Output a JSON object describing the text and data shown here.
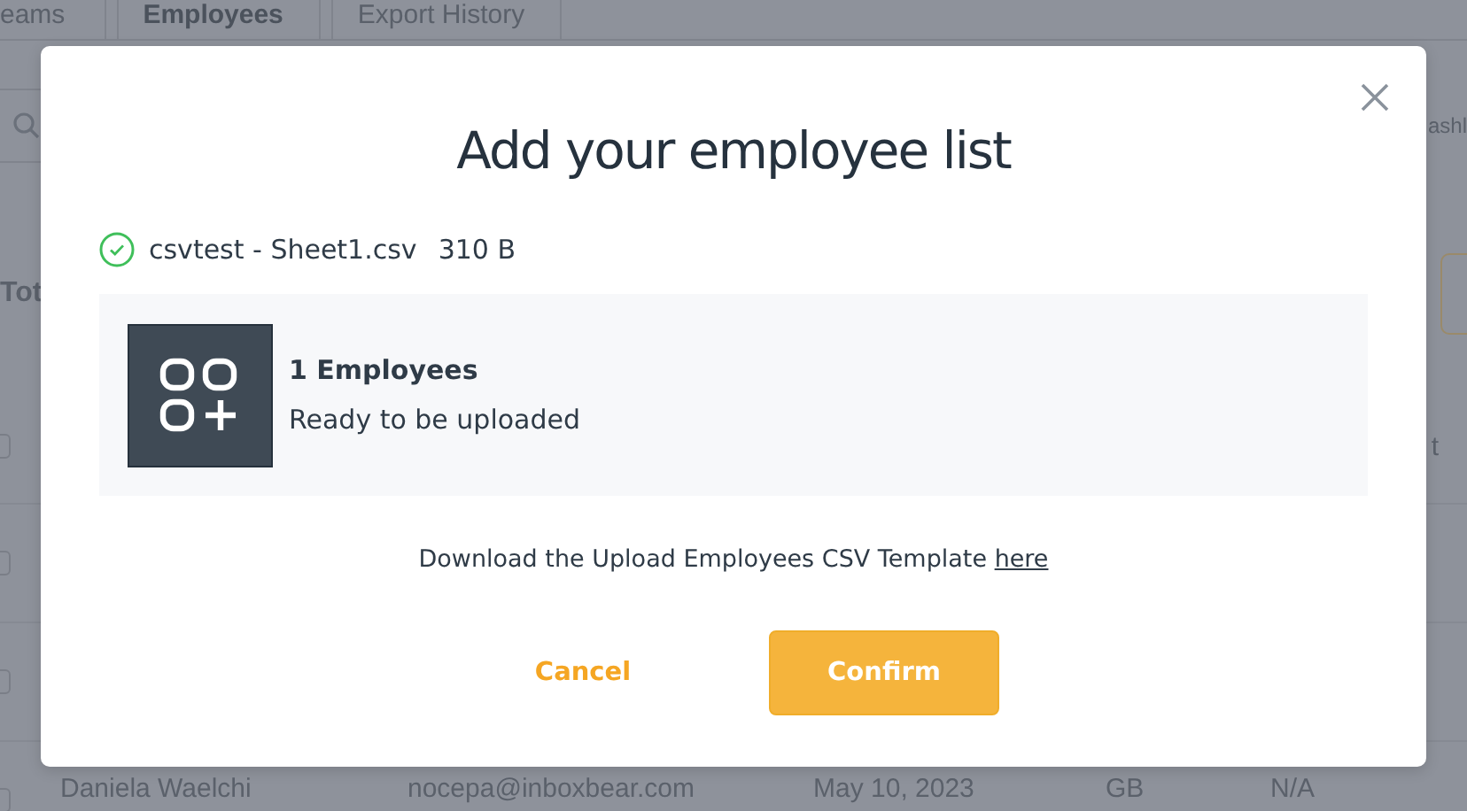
{
  "tabs": [
    {
      "label": "eams",
      "selected": false
    },
    {
      "label": "Employees",
      "selected": true
    },
    {
      "label": "Export History",
      "selected": false
    }
  ],
  "toolbar": {
    "right_partial": "ashl"
  },
  "summary_partial": "Tot",
  "table": {
    "header": {
      "checked": false,
      "column_partial": "t"
    },
    "rows": [
      {
        "checked": false
      },
      {
        "checked": false
      },
      {
        "checked": false,
        "cells": [
          "Daniela Waelchi",
          "nocepa@inboxbear.com",
          "May 10, 2023",
          "GB",
          "N/A"
        ]
      }
    ]
  },
  "modal": {
    "title": "Add your employee list",
    "file": {
      "name": "csvtest - Sheet1.csv",
      "size": "310 B",
      "valid": true
    },
    "result": {
      "count": "1 Employees",
      "message": "Ready to be uploaded"
    },
    "template_note": {
      "text": "Download the Upload Employees CSV Template",
      "link": "here"
    },
    "buttons": [
      {
        "label": "Cancel",
        "kind": "text"
      },
      {
        "label": "Confirm",
        "kind": "primary"
      }
    ]
  }
}
